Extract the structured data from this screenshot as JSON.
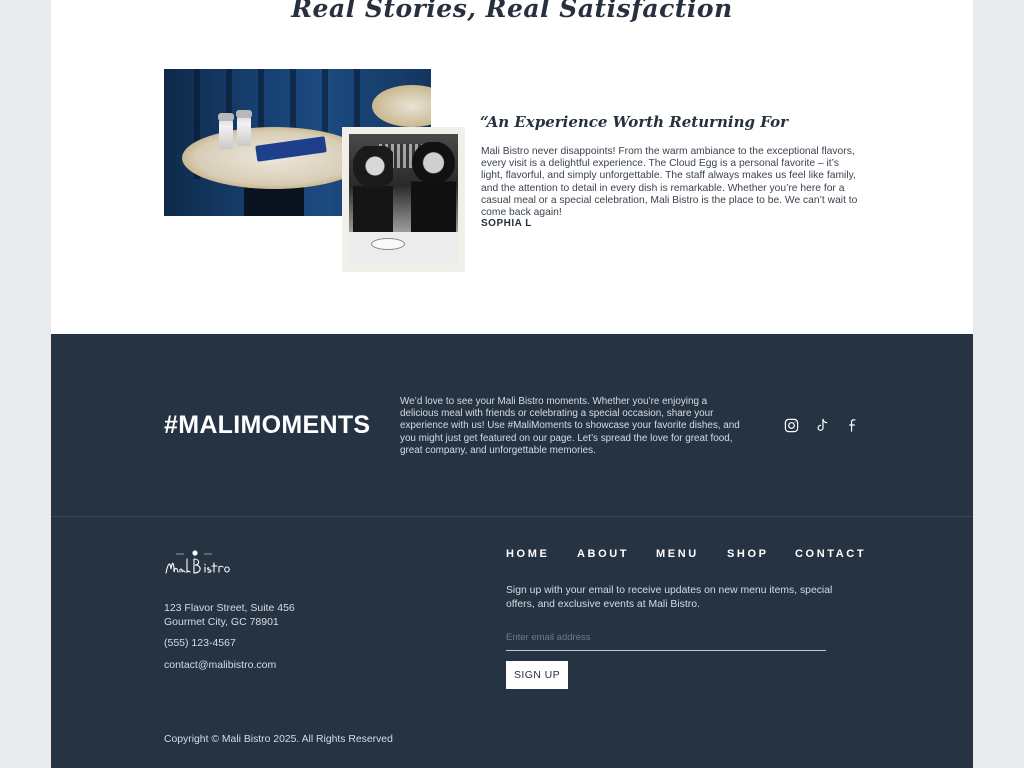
{
  "testimonial": {
    "heading": "Real Stories, Real Satisfaction",
    "quote_title": "“An Experience Worth Returning For",
    "quote_body": "Mali Bistro never disappoints! From the warm ambiance to the exceptional flavors, every visit is a delightful experience. The Cloud Egg is a personal favorite – it’s light, flavorful, and simply unforgettable. The staff always makes us feel like family, and the attention to detail in every dish is remarkable. Whether you’re here for a casual meal or a special celebration, Mali Bistro is the place to be. We can’t wait to come back again!",
    "author": "SOPHIA L"
  },
  "moments": {
    "title": "#MALIMOMENTS",
    "text": "We’d love to see your Mali Bistro moments. Whether you’re enjoying a delicious meal with friends or celebrating a special occasion, share your experience with us! Use #MaliMoments to showcase your favorite dishes, and you might just get featured on our page. Let’s spread the love for great food, great company, and unforgettable memories.",
    "social_icons": [
      "instagram-icon",
      "tiktok-icon",
      "facebook-icon"
    ]
  },
  "footer": {
    "logo_text": "Mali Bistro",
    "address_line1": "123 Flavor Street, Suite 456",
    "address_line2": "Gourmet City, GC 78901",
    "phone": "(555) 123-4567",
    "email": "contact@malibistro.com",
    "nav": [
      "HOME",
      "ABOUT",
      "MENU",
      "SHOP",
      "CONTACT"
    ],
    "signup_text": "Sign up with your email to receive updates on new menu items, special offers, and exclusive events at Mali Bistro.",
    "email_placeholder": "Enter email address",
    "signup_button": "SIGN UP",
    "copyright": "Copyright © Mali Bistro 2025. All Rights Reserved"
  },
  "colors": {
    "navy": "#263343",
    "white": "#ffffff",
    "text_dark": "#26303e",
    "background": "#e9eaec"
  }
}
